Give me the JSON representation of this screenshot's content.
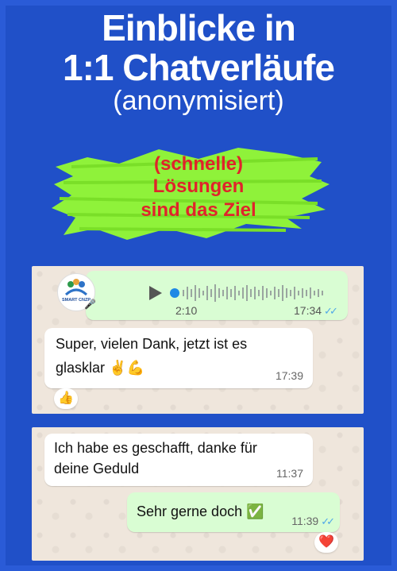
{
  "header": {
    "line1": "Einblicke in",
    "line2": "1:1 Chatverläufe",
    "line3": "(anonymisiert)"
  },
  "badge": {
    "line1": "(schnelle)",
    "line2": "Lösungen",
    "line3": "sind das Ziel"
  },
  "chat1": {
    "voice": {
      "avatar_label": "SMART CNZP",
      "duration": "2:10",
      "time": "17:34",
      "status": "read"
    },
    "message": {
      "line1": "Super,  vielen Dank,  jetzt ist es",
      "line2": "glasklar ✌️💪",
      "time": "17:39",
      "reaction": "👍"
    }
  },
  "chat2": {
    "message_in": {
      "line1": "Ich habe es geschafft,  danke für",
      "line2": "deine Geduld",
      "time": "11:37"
    },
    "message_out": {
      "text": "Sehr gerne doch ✅",
      "time": "11:39",
      "reaction": "❤️"
    }
  },
  "colors": {
    "background": "#2050c8",
    "splash": "#8ff23a",
    "badge_text": "#e0232b",
    "chat_bg": "#efe6dc",
    "outgoing": "#d9fdd3",
    "incoming": "#ffffff",
    "tick": "#4fa8e8"
  }
}
